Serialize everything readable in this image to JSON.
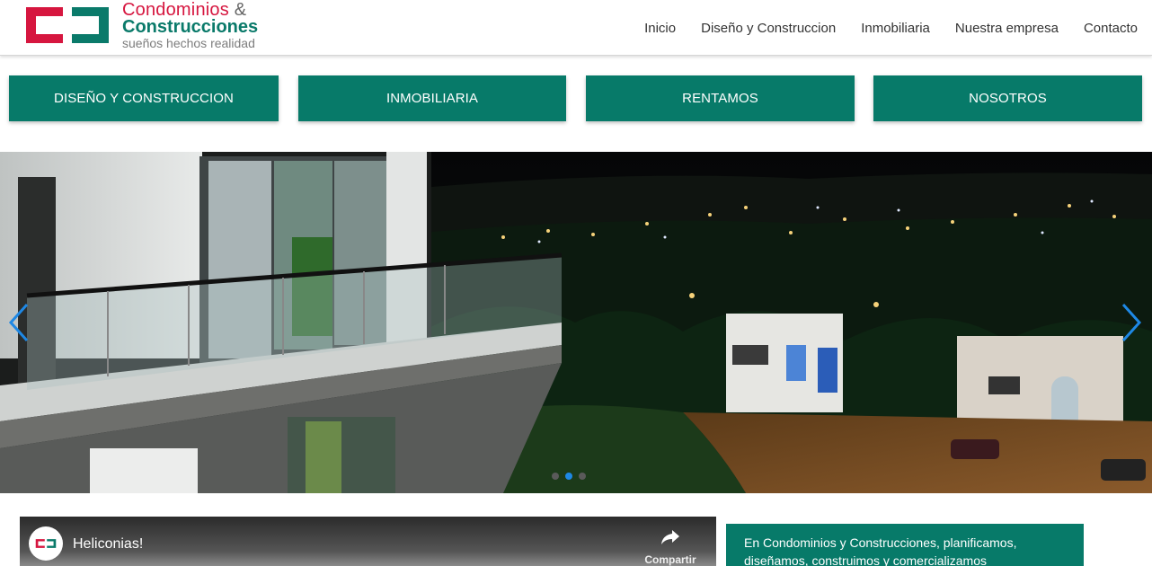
{
  "brand": {
    "line1": "Condominios",
    "amp": "&",
    "line2": "Construcciones",
    "tagline": "sueños hechos realidad",
    "red": "#d6163f",
    "teal": "#0a7a6a"
  },
  "nav": {
    "items": [
      "Inicio",
      "Diseño y Construccion",
      "Inmobiliaria",
      "Nuestra empresa",
      "Contacto"
    ]
  },
  "categories": [
    "DISEÑO Y CONSTRUCCION",
    "INMOBILIARIA",
    "RENTAMOS",
    "NOSOTROS"
  ],
  "carousel": {
    "prev_icon": "chevron-left-icon",
    "next_icon": "chevron-right-icon",
    "slide_count": 3,
    "active_index": 1
  },
  "video": {
    "title": "Heliconias!",
    "share_label": "Compartir",
    "share_icon": "share-arrow-icon"
  },
  "info": {
    "text": "En Condominios y Construcciones, planificamos, diseñamos, construimos y comercializamos"
  },
  "colors": {
    "accent_teal": "#077a69",
    "active_dot": "#1e88e5",
    "arrow_blue": "#1e88e5"
  }
}
